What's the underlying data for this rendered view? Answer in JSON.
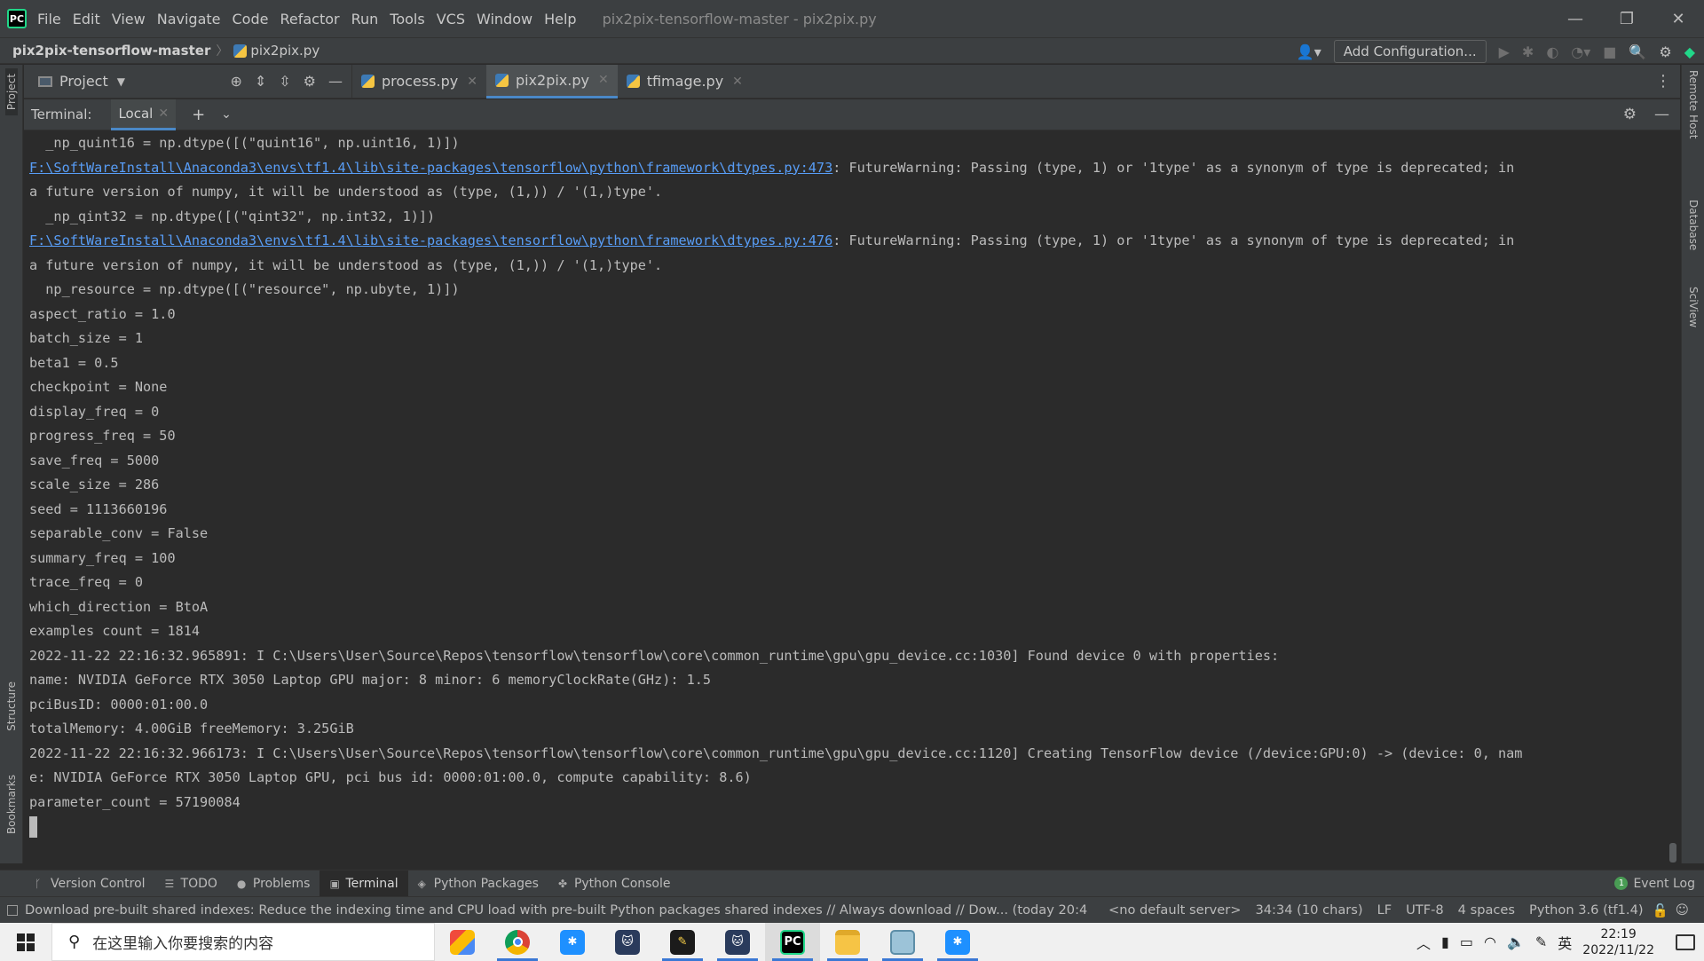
{
  "menubar": {
    "logo": "PC",
    "items": [
      "File",
      "Edit",
      "View",
      "Navigate",
      "Code",
      "Refactor",
      "Run",
      "Tools",
      "VCS",
      "Window",
      "Help"
    ],
    "window_title": "pix2pix-tensorflow-master - pix2pix.py",
    "controls": {
      "minimize": "—",
      "restore": "❐",
      "close": "✕"
    }
  },
  "navbar": {
    "project": "pix2pix-tensorflow-master",
    "file": "pix2pix.py",
    "add_configuration": "Add Configuration..."
  },
  "left_stripe": {
    "project": "Project",
    "structure": "Structure",
    "bookmarks": "Bookmarks"
  },
  "right_stripe": {
    "remote_host": "Remote Host",
    "database": "Database",
    "sciview": "SciView"
  },
  "project_tool": {
    "label": "Project"
  },
  "editor_tabs": [
    {
      "label": "process.py",
      "active": false
    },
    {
      "label": "pix2pix.py",
      "active": true
    },
    {
      "label": "tfimage.py",
      "active": false
    }
  ],
  "terminal": {
    "label": "Terminal:",
    "tab": "Local",
    "lines": [
      {
        "text": "  _np_quint16 = np.dtype([(\"quint16\", np.uint16, 1)])"
      },
      {
        "link": "F:\\SoftWareInstall\\Anaconda3\\envs\\tf1.4\\lib\\site-packages\\tensorflow\\python\\framework\\dtypes.py:473",
        "text": ": FutureWarning: Passing (type, 1) or '1type' as a synonym of type is deprecated; in"
      },
      {
        "text": "a future version of numpy, it will be understood as (type, (1,)) / '(1,)type'."
      },
      {
        "text": "  _np_qint32 = np.dtype([(\"qint32\", np.int32, 1)])"
      },
      {
        "link": "F:\\SoftWareInstall\\Anaconda3\\envs\\tf1.4\\lib\\site-packages\\tensorflow\\python\\framework\\dtypes.py:476",
        "text": ": FutureWarning: Passing (type, 1) or '1type' as a synonym of type is deprecated; in"
      },
      {
        "text": "a future version of numpy, it will be understood as (type, (1,)) / '(1,)type'."
      },
      {
        "text": "  np_resource = np.dtype([(\"resource\", np.ubyte, 1)])"
      },
      {
        "text": "aspect_ratio = 1.0"
      },
      {
        "text": "batch_size = 1"
      },
      {
        "text": "beta1 = 0.5"
      },
      {
        "text": "checkpoint = None"
      },
      {
        "text": "display_freq = 0"
      },
      {
        "text": "progress_freq = 50"
      },
      {
        "text": "save_freq = 5000"
      },
      {
        "text": "scale_size = 286"
      },
      {
        "text": "seed = 1113660196"
      },
      {
        "text": "separable_conv = False"
      },
      {
        "text": "summary_freq = 100"
      },
      {
        "text": "trace_freq = 0"
      },
      {
        "text": "which_direction = BtoA"
      },
      {
        "text": "examples count = 1814"
      },
      {
        "text": "2022-11-22 22:16:32.965891: I C:\\Users\\User\\Source\\Repos\\tensorflow\\tensorflow\\core\\common_runtime\\gpu\\gpu_device.cc:1030] Found device 0 with properties:"
      },
      {
        "text": "name: NVIDIA GeForce RTX 3050 Laptop GPU major: 8 minor: 6 memoryClockRate(GHz): 1.5"
      },
      {
        "text": "pciBusID: 0000:01:00.0"
      },
      {
        "text": "totalMemory: 4.00GiB freeMemory: 3.25GiB"
      },
      {
        "text": "2022-11-22 22:16:32.966173: I C:\\Users\\User\\Source\\Repos\\tensorflow\\tensorflow\\core\\common_runtime\\gpu\\gpu_device.cc:1120] Creating TensorFlow device (/device:GPU:0) -> (device: 0, nam"
      },
      {
        "text": "e: NVIDIA GeForce RTX 3050 Laptop GPU, pci bus id: 0000:01:00.0, compute capability: 8.6)"
      },
      {
        "text": "parameter_count = 57190084"
      }
    ]
  },
  "bottom_tools": [
    {
      "label": "Version Control",
      "icon": "branch-icon",
      "active": false
    },
    {
      "label": "TODO",
      "icon": "list-icon",
      "active": false
    },
    {
      "label": "Problems",
      "icon": "info-icon",
      "active": false
    },
    {
      "label": "Terminal",
      "icon": "terminal-icon",
      "active": true
    },
    {
      "label": "Python Packages",
      "icon": "layers-icon",
      "active": false
    },
    {
      "label": "Python Console",
      "icon": "python-icon",
      "active": false
    }
  ],
  "event_log": {
    "label": "Event Log",
    "count": "1"
  },
  "statusbar": {
    "message": "Download pre-built shared indexes: Reduce the indexing time and CPU load with pre-built Python packages shared indexes // Always download // Dow... (today 20:4",
    "server": "<no default server>",
    "position": "34:34 (10 chars)",
    "line_sep": "LF",
    "encoding": "UTF-8",
    "indent": "4 spaces",
    "interpreter": "Python 3.6 (tf1.4)"
  },
  "taskbar": {
    "search_placeholder": "在这里输入你要搜索的内容",
    "ime": "英",
    "time": "22:19",
    "date": "2022/11/22"
  }
}
